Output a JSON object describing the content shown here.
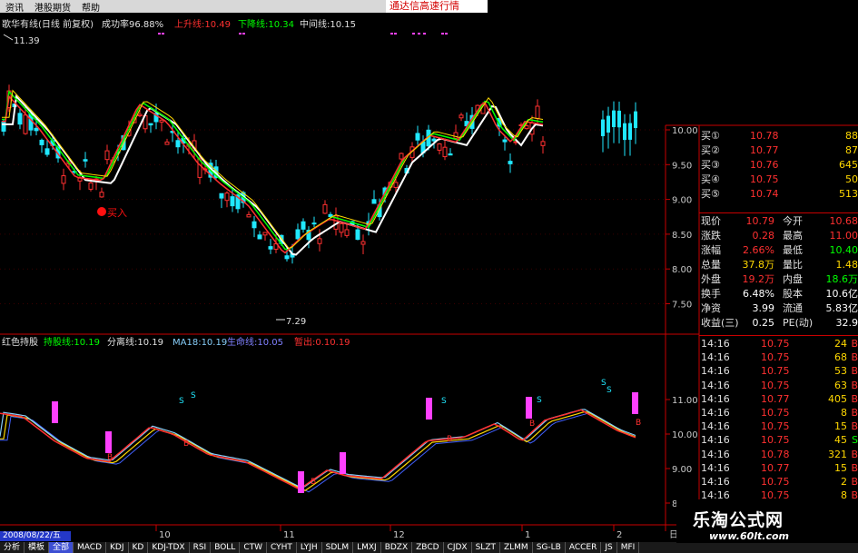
{
  "menu": {
    "items": [
      "资讯",
      "港股期货",
      "帮助"
    ],
    "ad_text": "通达信高速行情"
  },
  "main_chart": {
    "title": "歌华有线(日线 前复权)",
    "success_rate": "成功率96.88%",
    "up_line": "上升线:10.49",
    "down_line": "下降线:10.34",
    "mid_line": "中间线:10.15",
    "high_marker": "11.39",
    "low_marker": "7.29",
    "buy_label": "买入",
    "y_ticks": [
      "10.00",
      "9.50",
      "9.00",
      "8.50",
      "8.00",
      "7.50"
    ],
    "colors": {
      "up": "#ff3030",
      "down": "#20e8ff",
      "white": "#ffffff",
      "green": "#00ff00",
      "yellow": "#ffd800"
    }
  },
  "sub_chart": {
    "name": "红色持股",
    "l1": "持股线:10.19",
    "l2": "分离线:10.19",
    "l3": "MA18:10.19",
    "l4": "生命线:10.05",
    "l5": "暂出:0.10.19",
    "y_ticks": [
      "11.00",
      "10.00",
      "9.00",
      "8.00"
    ],
    "s_label": "S",
    "b_label": "B"
  },
  "x_axis": {
    "date": "2008/08/22/五",
    "labels": [
      "10",
      "11",
      "12",
      "1",
      "2"
    ],
    "right_tab": "日线"
  },
  "quote": {
    "buys": [
      {
        "label": "买①",
        "price": "10.78",
        "vol": "88"
      },
      {
        "label": "买②",
        "price": "10.77",
        "vol": "87"
      },
      {
        "label": "买③",
        "price": "10.76",
        "vol": "645"
      },
      {
        "label": "买④",
        "price": "10.75",
        "vol": "50"
      },
      {
        "label": "买⑤",
        "price": "10.74",
        "vol": "513"
      }
    ],
    "stats": [
      {
        "k1": "现价",
        "v1": "10.79",
        "k2": "今开",
        "v2": "10.68",
        "c1": "#ff3030",
        "c2": "#ff3030"
      },
      {
        "k1": "涨跌",
        "v1": "0.28",
        "k2": "最高",
        "v2": "11.00",
        "c1": "#ff3030",
        "c2": "#ff3030"
      },
      {
        "k1": "涨幅",
        "v1": "2.66%",
        "k2": "最低",
        "v2": "10.40",
        "c1": "#ff3030",
        "c2": "#00ff00"
      },
      {
        "k1": "总量",
        "v1": "37.8万",
        "k2": "量比",
        "v2": "1.48",
        "c1": "#ffd800",
        "c2": "#ffd800"
      },
      {
        "k1": "外盘",
        "v1": "19.2万",
        "k2": "内盘",
        "v2": "18.6万",
        "c1": "#ff3030",
        "c2": "#00ff00"
      },
      {
        "k1": "换手",
        "v1": "6.48%",
        "k2": "股本",
        "v2": "10.6亿",
        "c1": "#ffffff",
        "c2": "#ffffff"
      },
      {
        "k1": "净资",
        "v1": "3.99",
        "k2": "流通",
        "v2": "5.83亿",
        "c1": "#ffffff",
        "c2": "#ffffff"
      },
      {
        "k1": "收益(三)",
        "v1": "0.25",
        "k2": "PE(动)",
        "v2": "32.9",
        "c1": "#ffffff",
        "c2": "#ffffff"
      }
    ],
    "ticks": [
      {
        "time": "14:16",
        "price": "10.75",
        "vol": "24",
        "dir": "B"
      },
      {
        "time": "14:16",
        "price": "10.75",
        "vol": "68",
        "dir": "B"
      },
      {
        "time": "14:16",
        "price": "10.75",
        "vol": "53",
        "dir": "B"
      },
      {
        "time": "14:16",
        "price": "10.75",
        "vol": "63",
        "dir": "B"
      },
      {
        "time": "14:16",
        "price": "10.77",
        "vol": "405",
        "dir": "B"
      },
      {
        "time": "14:16",
        "price": "10.75",
        "vol": "8",
        "dir": "B"
      },
      {
        "time": "14:16",
        "price": "10.75",
        "vol": "15",
        "dir": "B"
      },
      {
        "time": "14:16",
        "price": "10.75",
        "vol": "45",
        "dir": "S"
      },
      {
        "time": "14:16",
        "price": "10.78",
        "vol": "321",
        "dir": "B"
      },
      {
        "time": "14:16",
        "price": "10.77",
        "vol": "15",
        "dir": "B"
      },
      {
        "time": "14:16",
        "price": "10.75",
        "vol": "2",
        "dir": "B"
      },
      {
        "time": "14:16",
        "price": "10.75",
        "vol": "8",
        "dir": "B"
      }
    ]
  },
  "bottom_tabs": [
    "分析",
    "模板",
    "全部",
    "MACD",
    "KDJ",
    "KD",
    "KDJ-TDX",
    "RSI",
    "BOLL",
    "CTW",
    "CYHT",
    "LYJH",
    "SDLM",
    "LMXJ",
    "BDZX",
    "ZBCD",
    "CJDX",
    "SLZT",
    "ZLMM",
    "SG-LB",
    "ACCER",
    "JS",
    "MFI"
  ],
  "logo": {
    "line1": "乐淘公式网",
    "line2": "www.60lt.com"
  }
}
